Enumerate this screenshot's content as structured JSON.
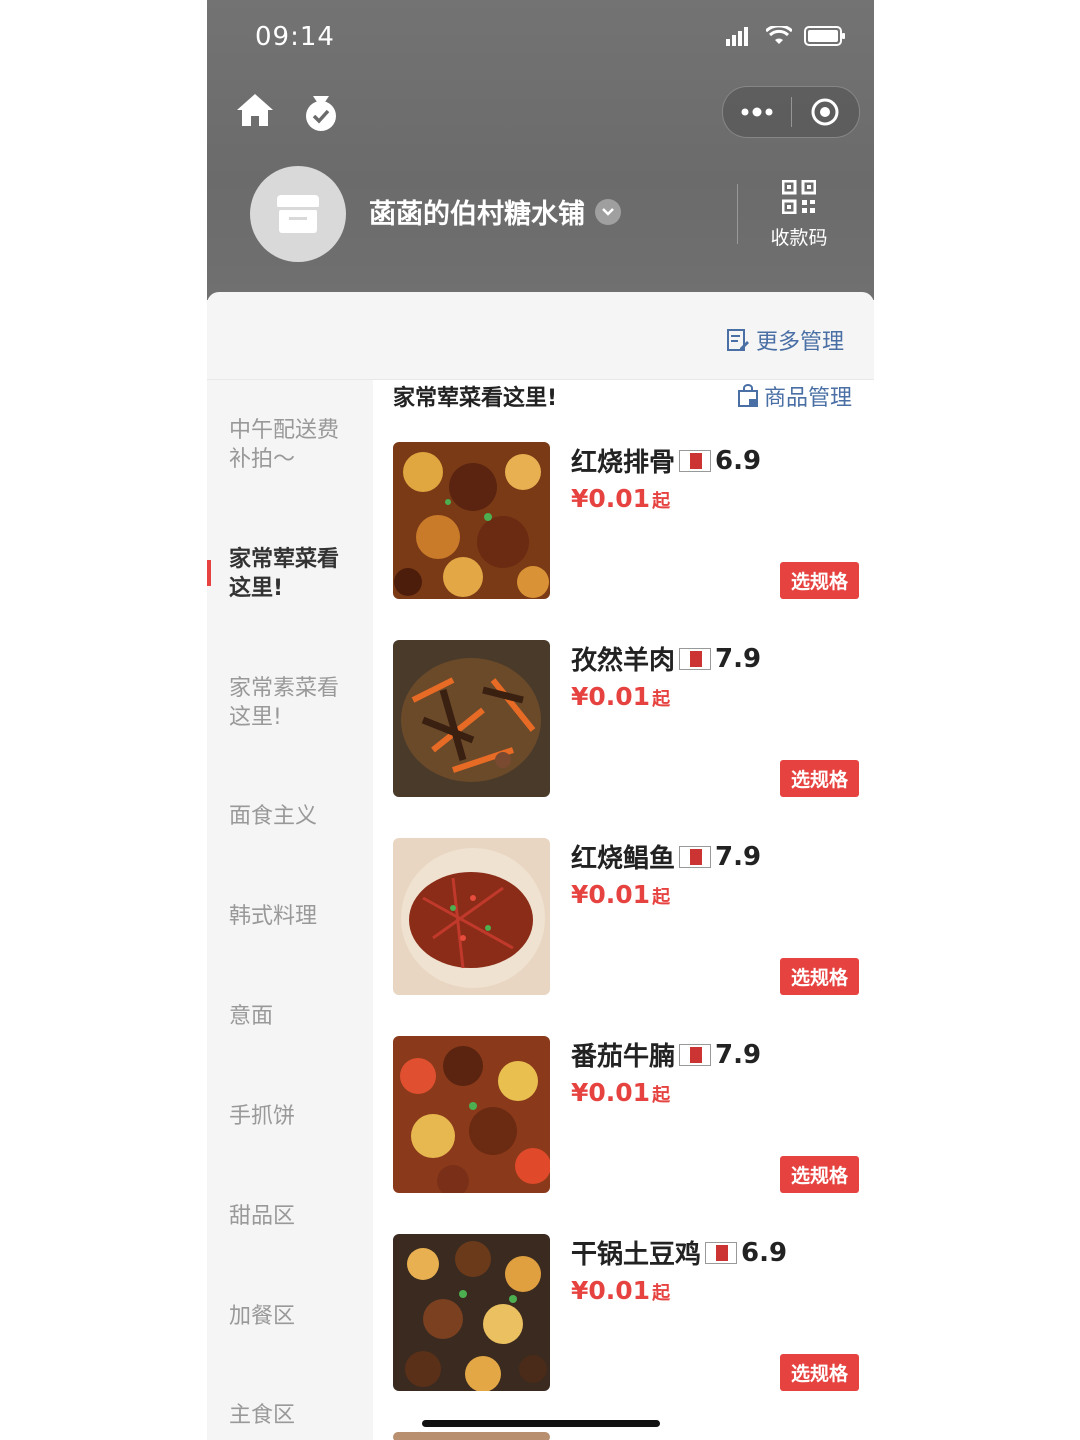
{
  "status_bar": {
    "time": "09:14"
  },
  "shop": {
    "name": "菡菡的伯村糖水铺",
    "qr_label": "收款码"
  },
  "toolbar": {
    "more_mgmt": "更多管理"
  },
  "sidebar": {
    "items": [
      {
        "label": "中午配送费补拍～",
        "active": false
      },
      {
        "label": "家常荤菜看这里!",
        "active": true
      },
      {
        "label": "家常素菜看这里!",
        "active": false
      },
      {
        "label": "面食主义",
        "active": false
      },
      {
        "label": "韩式料理",
        "active": false
      },
      {
        "label": "意面",
        "active": false
      },
      {
        "label": "手抓饼",
        "active": false
      },
      {
        "label": "甜品区",
        "active": false
      },
      {
        "label": "加餐区",
        "active": false
      },
      {
        "label": "主食区",
        "active": false
      }
    ]
  },
  "main": {
    "category_title": "家常荤菜看这里!",
    "goods_mgmt": "商品管理",
    "items": [
      {
        "name": "红烧排骨",
        "flag_price": "6.9",
        "price": "¥0.01",
        "price_suffix": "起",
        "spec_button": "选规格"
      },
      {
        "name": "孜然羊肉",
        "flag_price": "7.9",
        "price": "¥0.01",
        "price_suffix": "起",
        "spec_button": "选规格"
      },
      {
        "name": "红烧鲳鱼",
        "flag_price": "7.9",
        "price": "¥0.01",
        "price_suffix": "起",
        "spec_button": "选规格"
      },
      {
        "name": "番茄牛腩",
        "flag_price": "7.9",
        "price": "¥0.01",
        "price_suffix": "起",
        "spec_button": "选规格"
      },
      {
        "name": "干锅土豆鸡",
        "flag_price": "6.9",
        "price": "¥0.01",
        "price_suffix": "起",
        "spec_button": "选规格"
      }
    ]
  },
  "colors": {
    "accent_red": "#e64340",
    "link_blue": "#4a6fa5"
  }
}
